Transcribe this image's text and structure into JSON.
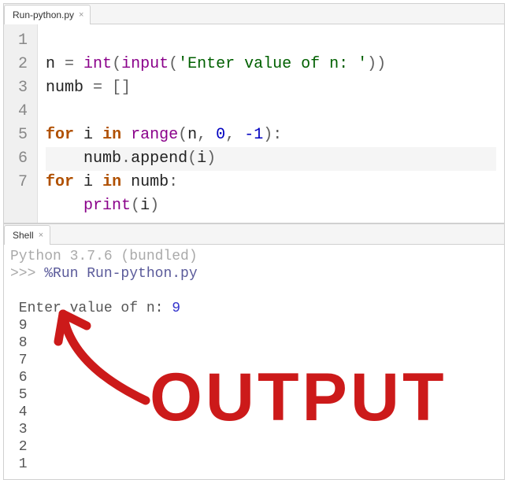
{
  "editor": {
    "tab_label": "Run-python.py",
    "close_glyph": "×",
    "line_numbers": [
      "1",
      "2",
      "3",
      "4",
      "5",
      "6",
      "7"
    ],
    "code": {
      "l1_var": "n",
      "l1_eq": " = ",
      "l1_int": "int",
      "l1_op1": "(",
      "l1_input": "input",
      "l1_op2": "(",
      "l1_str": "'Enter value of n: '",
      "l1_cl": "))",
      "l2_var": "numb",
      "l2_eq": " = ",
      "l2_br": "[]",
      "l4_for": "for",
      "l4_sp1": " ",
      "l4_i": "i",
      "l4_sp2": " ",
      "l4_in": "in",
      "l4_sp3": " ",
      "l4_range": "range",
      "l4_op": "(",
      "l4_n": "n",
      "l4_c1": ", ",
      "l4_z": "0",
      "l4_c2": ", ",
      "l4_m1": "-1",
      "l4_cl": "):",
      "l5_ind": "    ",
      "l5_numb": "numb",
      "l5_dot": ".",
      "l5_append": "append",
      "l5_op": "(",
      "l5_i": "i",
      "l5_cl": ")",
      "l6_for": "for",
      "l6_sp1": " ",
      "l6_i": "i",
      "l6_sp2": " ",
      "l6_in": "in",
      "l6_sp3": " ",
      "l6_numb": "numb",
      "l6_col": ":",
      "l7_ind": "    ",
      "l7_print": "print",
      "l7_op": "(",
      "l7_i": "i",
      "l7_cl": ")"
    }
  },
  "shell": {
    "tab_label": "Shell",
    "close_glyph": "×",
    "version": "Python 3.7.6 (bundled)",
    "prompt": ">>> ",
    "command": "%Run Run-python.py",
    "input_prompt": " Enter value of n: ",
    "input_value": "9",
    "output_lines": [
      " 9",
      " 8",
      " 7",
      " 6",
      " 5",
      " 4",
      " 3",
      " 2",
      " 1"
    ]
  },
  "annotation": {
    "text": "OUTPUT",
    "color": "#cc1a1a"
  }
}
